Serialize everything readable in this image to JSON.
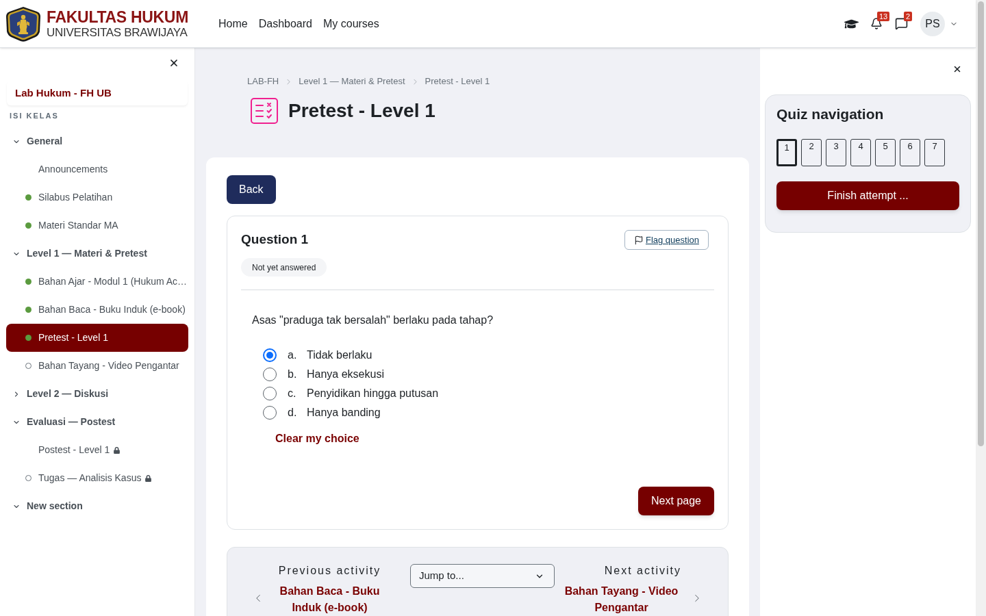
{
  "header": {
    "logo": {
      "line_1": "FAKULTAS HUKUM",
      "line_2": "UNIVERSITAS BRAWIJAYA"
    },
    "nav": [
      "Home",
      "Dashboard",
      "My courses"
    ],
    "notifications": {
      "count": "13"
    },
    "messages": {
      "count": "2"
    },
    "user": {
      "initials": "PS"
    }
  },
  "course_index": {
    "course_title": "Lab Hukum - FH UB",
    "heading": "ISI KELAS",
    "sections": [
      {
        "title": "General",
        "expanded": true,
        "children": [
          {
            "label": "Announcements",
            "locked": false,
            "selected": false
          },
          {
            "label": "Silabus Pelatihan",
            "completed": true,
            "locked": false,
            "selected": false
          },
          {
            "label": "Materi Standar MA",
            "completed": true,
            "locked": false,
            "selected": false
          }
        ]
      },
      {
        "title": "Level 1 — Materi & Pretest",
        "expanded": true,
        "children": [
          {
            "label": "Bahan Ajar - Modul 1 (Hukum Ac…",
            "completed": true,
            "locked": false,
            "selected": false
          },
          {
            "label": "Bahan Baca - Buku Induk (e-book)",
            "completed": true,
            "locked": false,
            "selected": false
          },
          {
            "label": "Pretest - Level 1",
            "completed": true,
            "locked": false,
            "selected": true
          },
          {
            "label": "Bahan Tayang - Video Pengantar",
            "completed": false,
            "locked": false,
            "selected": false
          }
        ]
      },
      {
        "title": "Level 2 — Diskusi",
        "expanded": false
      },
      {
        "title": "Evaluasi — Postest",
        "expanded": true,
        "children": [
          {
            "label": "Postest - Level 1",
            "locked": true,
            "selected": false
          },
          {
            "label": "Tugas — Analisis Kasus",
            "completed": false,
            "locked": true,
            "selected": false
          }
        ]
      },
      {
        "title": "New section",
        "expanded": true
      }
    ]
  },
  "page_header": {
    "breadcrumb": [
      "LAB-FH",
      "Level 1 — Materi & Pretest",
      "Pretest - Level 1"
    ],
    "title": "Pretest - Level 1"
  },
  "back_button": "Back",
  "question": {
    "title": "Question 1",
    "status": "Not yet answered",
    "flag_button": "Flag question",
    "text": "Asas \"praduga tak bersalah\" berlaku pada tahap?",
    "options": [
      {
        "letter": "a.",
        "text": "Tidak berlaku",
        "checked": true
      },
      {
        "letter": "b.",
        "text": "Hanya eksekusi",
        "checked": false
      },
      {
        "letter": "c.",
        "text": "Penyidikan hingga putusan",
        "checked": false
      },
      {
        "letter": "d.",
        "text": "Hanya banding",
        "checked": false
      }
    ],
    "clear_choice": "Clear my choice",
    "next_button": "Next page"
  },
  "activity_navigation": {
    "previous": {
      "label": "Previous activity",
      "link": "Bahan Baca - Buku Induk (e-book)"
    },
    "jump_select": {
      "value": "Jump to..."
    },
    "next": {
      "label": "Next activity",
      "link": "Bahan Tayang - Video Pengantar"
    }
  },
  "quiz_navigation": {
    "title": "Quiz navigation",
    "questions": [
      {
        "label": "1",
        "selected": true
      },
      {
        "label": "2",
        "selected": false
      },
      {
        "label": "3",
        "selected": false
      },
      {
        "label": "4",
        "selected": false
      },
      {
        "label": "5",
        "selected": false
      },
      {
        "label": "6",
        "selected": false
      },
      {
        "label": "7",
        "selected": false
      }
    ],
    "finish_button": "Finish attempt ..."
  }
}
